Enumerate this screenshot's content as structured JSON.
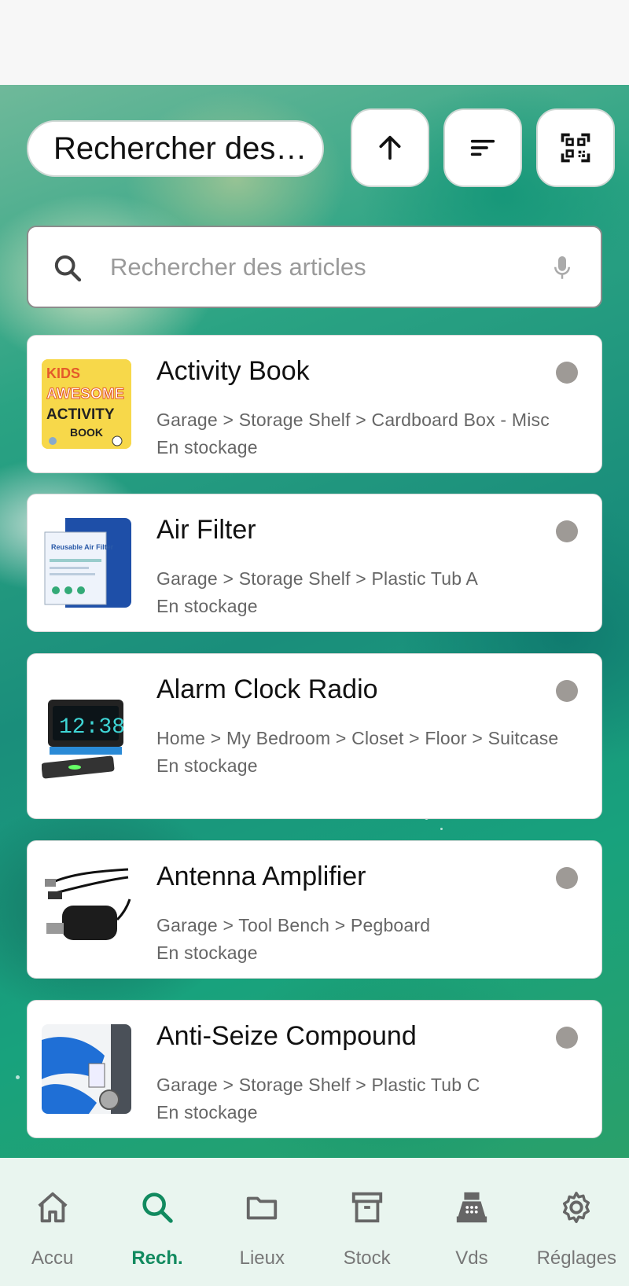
{
  "header": {
    "title": "Rechercher des articles"
  },
  "search": {
    "placeholder": "Rechercher des articles"
  },
  "colors": {
    "accent": "#118a5f",
    "nav_bg": "#e9f5ef",
    "status_dot": "#9e9a96"
  },
  "items": [
    {
      "name": "Activity Book",
      "location": "Garage > Storage Shelf > Cardboard Box - Misc",
      "status": "En stockage"
    },
    {
      "name": "Air Filter",
      "location": "Garage > Storage Shelf > Plastic Tub A",
      "status": "En stockage"
    },
    {
      "name": "Alarm Clock Radio",
      "location": "Home > My Bedroom > Closet > Floor > Suitcase",
      "status": "En stockage",
      "clock_display": "12:38"
    },
    {
      "name": "Antenna Amplifier",
      "location": "Garage > Tool Bench > Pegboard",
      "status": "En stockage"
    },
    {
      "name": "Anti-Seize Compound",
      "location": "Garage > Storage Shelf > Plastic Tub C",
      "status": "En stockage"
    }
  ],
  "thumb_text": {
    "book_kids": "KIDS",
    "book_awesome": "AWESOME",
    "book_activity": "ACTIVITY",
    "book_book": "BOOK",
    "filter_label": "Reusable Air Filter"
  },
  "nav": [
    {
      "label": "Accu",
      "icon": "home-icon",
      "active": false
    },
    {
      "label": "Rech.",
      "icon": "search-icon",
      "active": true
    },
    {
      "label": "Lieux",
      "icon": "folder-icon",
      "active": false
    },
    {
      "label": "Stock",
      "icon": "archive-icon",
      "active": false
    },
    {
      "label": "Vds",
      "icon": "cash-register-icon",
      "active": false
    },
    {
      "label": "Réglages",
      "icon": "gear-icon",
      "active": false
    }
  ]
}
